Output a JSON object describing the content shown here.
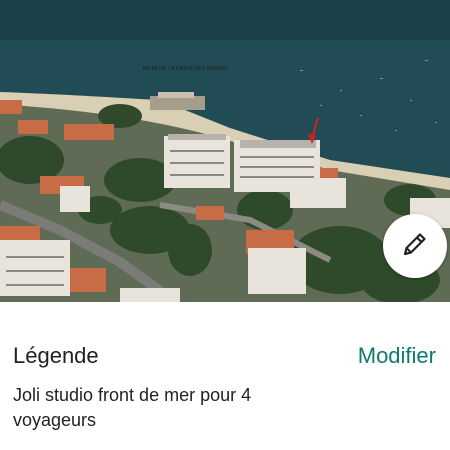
{
  "photo": {
    "caption": "ROTE DE LA CROIX DES MARINS",
    "marker_color": "#d0231f"
  },
  "edit_button": {
    "icon": "pencil-icon"
  },
  "caption_section": {
    "title": "Légende",
    "modify_label": "Modifier",
    "text": "Joli studio front de mer pour 4 voyageurs"
  },
  "colors": {
    "accent": "#0e7c6b",
    "text": "#222222",
    "sea": "#1f4a52"
  }
}
